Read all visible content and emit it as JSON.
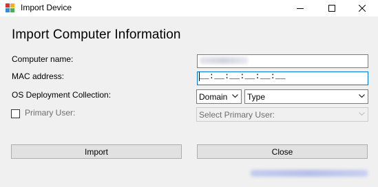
{
  "window": {
    "title": "Import Device",
    "icon": "window-app-icon",
    "controls": {
      "minimize": "minimize-icon",
      "maximize": "maximize-icon",
      "close": "close-icon"
    }
  },
  "form": {
    "heading": "Import Computer Information",
    "computer_name": {
      "label": "Computer name:",
      "value": ""
    },
    "mac_address": {
      "label": "MAC address:",
      "mask": "__:__:__:__:__:__"
    },
    "os_deployment": {
      "label": "OS Deployment Collection:",
      "scope_value": "Domain",
      "type_value": "Type"
    },
    "primary_user": {
      "label": "Primary User:",
      "checked": false,
      "placeholder": "Select Primary User:"
    }
  },
  "buttons": {
    "import": "Import",
    "close": "Close"
  },
  "colors": {
    "focus_border": "#0078d7",
    "window_bg": "#f0f0f0"
  }
}
